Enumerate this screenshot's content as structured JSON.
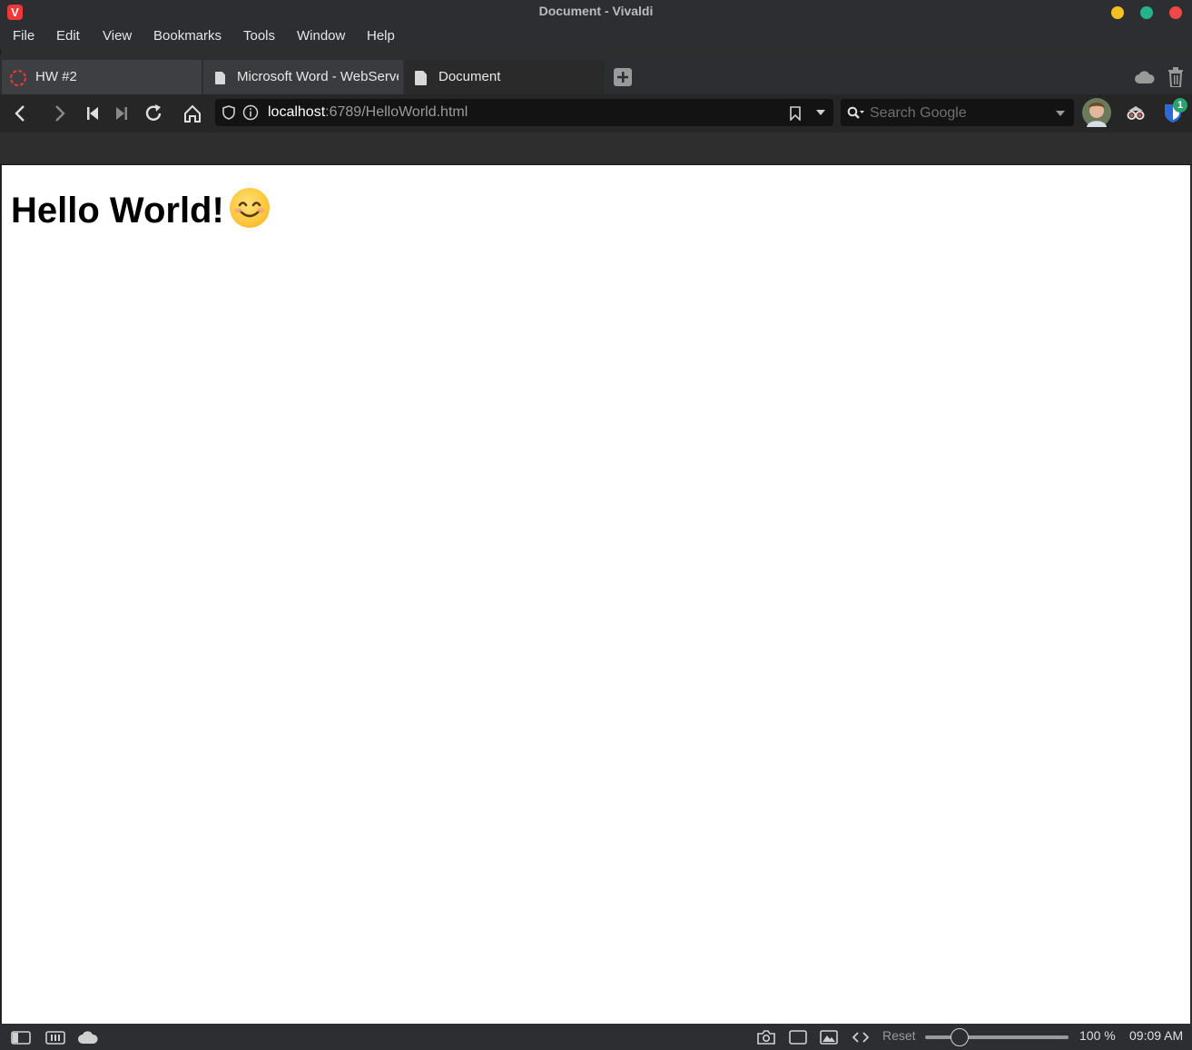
{
  "window": {
    "title": "Document - Vivaldi",
    "logo_letter": "V"
  },
  "menu": [
    "File",
    "Edit",
    "View",
    "Bookmarks",
    "Tools",
    "Window",
    "Help"
  ],
  "tabs": [
    {
      "label": "HW #2",
      "icon": "spinner-icon",
      "state": "inactive"
    },
    {
      "label": "Microsoft Word - WebServe",
      "icon": "document-icon",
      "state": "inactive"
    },
    {
      "label": "Document",
      "icon": "document-icon",
      "state": "active"
    }
  ],
  "address": {
    "host": "localhost",
    "rest": ":6789/HelloWorld.html"
  },
  "search": {
    "placeholder": "Search Google"
  },
  "extensions": {
    "bitwarden_badge": "1"
  },
  "page": {
    "heading": "Hello World!"
  },
  "status": {
    "reset_label": "Reset",
    "zoom": "100 %",
    "zoom_fraction": 0.2,
    "clock": "09:09 AM"
  },
  "colors": {
    "accent_red": "#ef3939",
    "min_button": "#f5c021",
    "max_button": "#24b38a",
    "close_button": "#f04848"
  }
}
